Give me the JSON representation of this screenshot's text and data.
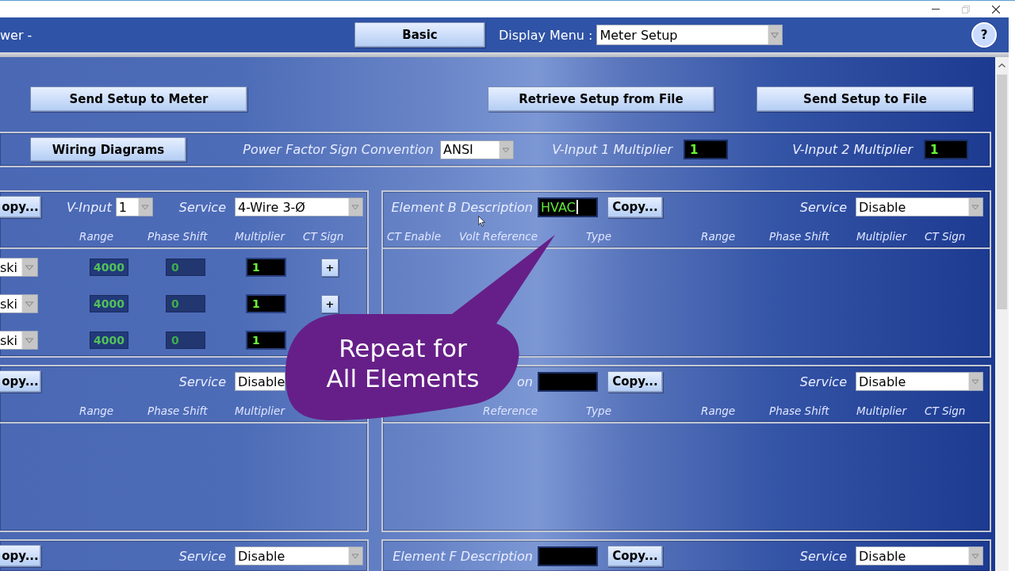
{
  "header": {
    "title": "wer -",
    "mode_button": "Basic",
    "display_menu": {
      "label": "Display Menu :",
      "value": "Meter Setup"
    },
    "help_button": "?"
  },
  "actions": [
    "Send Setup to Meter",
    "Retrieve Setup from File",
    "Send Setup to File"
  ],
  "settings": {
    "wiring_button": "Wiring Diagrams",
    "power_factor": {
      "label": "Power Factor Sign Convention",
      "value": "ANSI"
    },
    "multipliers": [
      {
        "label": "V-Input 1 Multiplier",
        "value": "1"
      },
      {
        "label": "V-Input 2 Multiplier",
        "value": "1"
      }
    ]
  },
  "elements": [
    {
      "kind": "clipped",
      "copy_button": "opy...",
      "v_input": {
        "label": "V-Input",
        "value": "1"
      },
      "service": {
        "label": "Service",
        "value": "4-Wire 3-Ø",
        "covered": false
      },
      "columns": [
        "Range",
        "Phase Shift",
        "Multiplier",
        "CT Sign"
      ],
      "rows": [
        {
          "type": "ski",
          "range": "4000",
          "phase_shift": "0",
          "multiplier": "1",
          "ct_sign": "+"
        },
        {
          "type": "ski",
          "range": "4000",
          "phase_shift": "0",
          "multiplier": "1",
          "ct_sign": "+"
        },
        {
          "type": "ski",
          "range": "4000",
          "phase_shift": "0",
          "multiplier": "1"
        }
      ]
    },
    {
      "kind": "full",
      "description": {
        "label": "Element B Description",
        "value": "HVAC",
        "focused": true
      },
      "copy_button": "Copy...",
      "service": {
        "label": "Service",
        "value": "Disable",
        "covered": false
      },
      "columns": [
        "CT Enable",
        "Volt Reference",
        "Type",
        "Range",
        "Phase Shift",
        "Multiplier",
        "CT Sign"
      ]
    },
    {
      "kind": "clipped",
      "copy_button": "opy...",
      "service": {
        "label": "Service",
        "value": "Disable",
        "covered": true
      },
      "columns": [
        "Range",
        "Phase Shift",
        "Multiplier",
        null
      ]
    },
    {
      "kind": "full",
      "description": {
        "label": "on",
        "focused": false
      },
      "copy_button": "Copy...",
      "service": {
        "label": "Service",
        "value": "Disable",
        "covered": false
      },
      "columns": [
        null,
        "Reference",
        "Type",
        "Range",
        "Phase Shift",
        "Multiplier",
        "CT Sign"
      ]
    },
    {
      "kind": "clipped",
      "copy_button": "opy...",
      "service": {
        "label": "Service",
        "value": "Disable",
        "covered": false
      }
    },
    {
      "kind": "full",
      "description": {
        "label": "Element F Description",
        "focused": false
      },
      "copy_button": "Copy...",
      "service": {
        "label": "Service",
        "value": "Disable",
        "covered": false
      }
    }
  ],
  "callout": {
    "lines": [
      "Repeat for",
      "All Elements"
    ]
  }
}
